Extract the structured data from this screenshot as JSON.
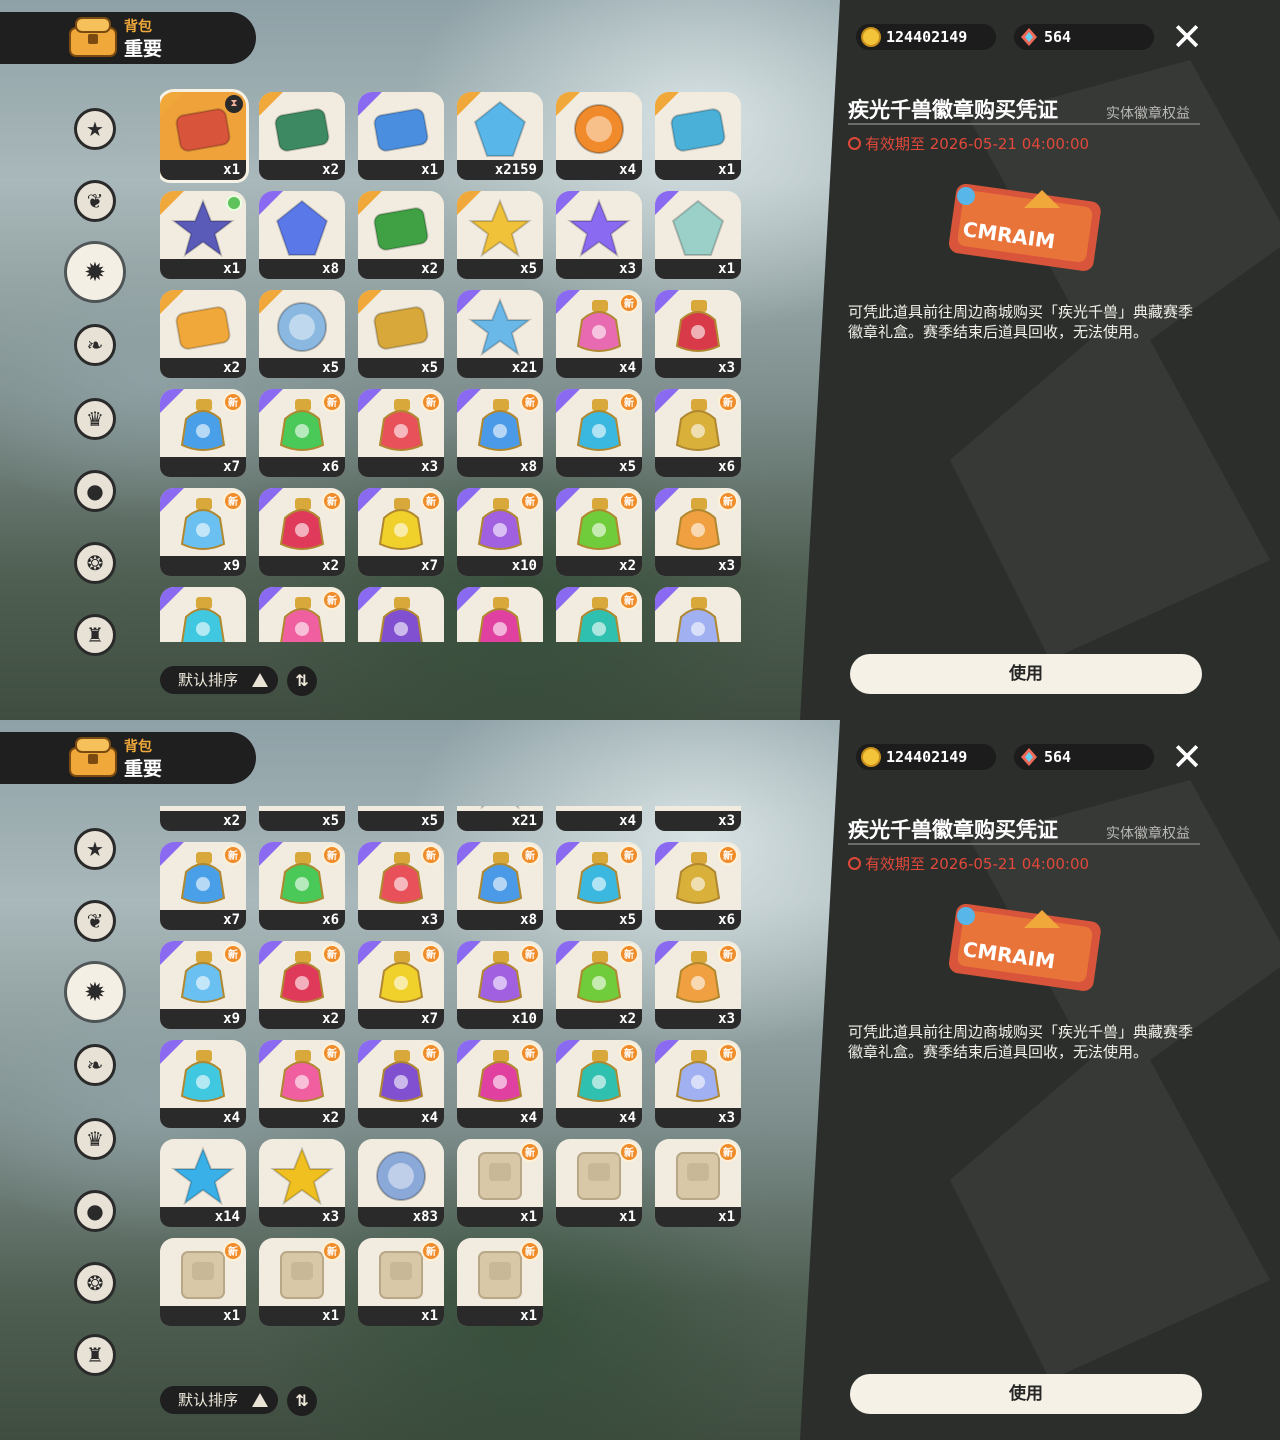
{
  "header": {
    "sub_label": "背包",
    "main_label": "重要"
  },
  "categories": [
    {
      "icon": "star-badge-icon",
      "active": false
    },
    {
      "icon": "leaf-badge-icon",
      "active": false
    },
    {
      "icon": "important-star-icon",
      "active": true
    },
    {
      "icon": "plant-badge-icon",
      "active": false
    },
    {
      "icon": "crown-card-icon",
      "active": false
    },
    {
      "icon": "ball-icon",
      "active": false
    },
    {
      "icon": "acorn-icon",
      "active": false
    },
    {
      "icon": "furniture-icon",
      "active": false
    }
  ],
  "currency": {
    "coins": "124402149",
    "gems": "564"
  },
  "detail": {
    "title": "疾光千兽徽章购买凭证",
    "tag": "实体徽章权益",
    "expiry": "有效期至 2026-05-21 04:00:00",
    "description": "可凭此道具前往周边商城购买「疾光千兽」典藏赛季徽章礼盒。赛季结束后道具回收，无法使用。",
    "use_label": "使用"
  },
  "sort": {
    "label": "默认排序",
    "toggle_label": "⇅"
  },
  "new_badge": "新",
  "items_screen1": [
    {
      "name": "voucher-ticket",
      "count": "x1",
      "rarity": "gold",
      "selected": true,
      "timer": true,
      "color": "#d8543a"
    },
    {
      "name": "gift-envelope",
      "count": "x2",
      "rarity": "gold",
      "color": "#3d8a62"
    },
    {
      "name": "id-card",
      "count": "x1",
      "rarity": "purple",
      "color": "#4a8ee0"
    },
    {
      "name": "prism-crystal",
      "count": "x2159",
      "rarity": "gold",
      "color": "#58b6e8"
    },
    {
      "name": "orange-emblem",
      "count": "x4",
      "rarity": "gold",
      "color": "#f08a2a"
    },
    {
      "name": "water-flask",
      "count": "x1",
      "rarity": "gold",
      "color": "#4ab0d8"
    },
    {
      "name": "star-pouch",
      "count": "x1",
      "rarity": "gold",
      "green": true,
      "color": "#5a5ab8"
    },
    {
      "name": "blue-gem",
      "count": "x8",
      "rarity": "purple",
      "color": "#5a78e8"
    },
    {
      "name": "leaf-seed",
      "count": "x2",
      "rarity": "gold",
      "color": "#3fa044"
    },
    {
      "name": "gold-star",
      "count": "x5",
      "rarity": "gold",
      "color": "#f0c23a"
    },
    {
      "name": "purple-star",
      "count": "x3",
      "rarity": "purple",
      "color": "#8a6af0"
    },
    {
      "name": "crystal-crown",
      "count": "x1",
      "rarity": "purple",
      "color": "#9ad0c8"
    },
    {
      "name": "flame-mask",
      "count": "x2",
      "rarity": "gold",
      "color": "#f0a83a"
    },
    {
      "name": "blue-disc",
      "count": "x5",
      "rarity": "gold",
      "color": "#8ab8e0"
    },
    {
      "name": "golden-key",
      "count": "x5",
      "rarity": "gold",
      "color": "#d8a83a"
    },
    {
      "name": "star-wand",
      "count": "x21",
      "rarity": "purple",
      "color": "#6ab8e8"
    },
    {
      "name": "rainbow-potion",
      "count": "x4",
      "rarity": "purple",
      "new": true,
      "color": "#e86ab0"
    },
    {
      "name": "red-potion",
      "count": "x3",
      "rarity": "purple",
      "color": "#d83a4a"
    },
    {
      "name": "potion-blue-star",
      "count": "x7",
      "rarity": "purple",
      "new": true,
      "color": "#4aa0e8"
    },
    {
      "name": "potion-green",
      "count": "x6",
      "rarity": "purple",
      "new": true,
      "color": "#4ac858"
    },
    {
      "name": "potion-red",
      "count": "x3",
      "rarity": "purple",
      "new": true,
      "color": "#e8505a"
    },
    {
      "name": "potion-blue-drop",
      "count": "x8",
      "rarity": "purple",
      "new": true,
      "color": "#4a9ae8"
    },
    {
      "name": "potion-cyan",
      "count": "x5",
      "rarity": "purple",
      "new": true,
      "color": "#3ab8e0"
    },
    {
      "name": "potion-gold",
      "count": "x6",
      "rarity": "purple",
      "new": true,
      "color": "#d8b03a"
    },
    {
      "name": "potion-ice",
      "count": "x9",
      "rarity": "purple",
      "new": true,
      "color": "#6ac0f0"
    },
    {
      "name": "potion-crimson",
      "count": "x2",
      "rarity": "purple",
      "new": true,
      "color": "#e03a5a"
    },
    {
      "name": "potion-yellow",
      "count": "x7",
      "rarity": "purple",
      "new": true,
      "color": "#f0d02a"
    },
    {
      "name": "potion-violet",
      "count": "x10",
      "rarity": "purple",
      "new": true,
      "color": "#a060e0"
    },
    {
      "name": "potion-lime",
      "count": "x2",
      "rarity": "purple",
      "new": true,
      "color": "#70cc3a"
    },
    {
      "name": "potion-orange",
      "count": "x3",
      "rarity": "purple",
      "new": true,
      "color": "#f0a040"
    },
    {
      "name": "potion-aqua",
      "count": "",
      "rarity": "purple",
      "color": "#40c8e0"
    },
    {
      "name": "potion-pink",
      "count": "",
      "rarity": "purple",
      "new": true,
      "color": "#f060a0"
    },
    {
      "name": "potion-purple",
      "count": "",
      "rarity": "purple",
      "color": "#8050d0"
    },
    {
      "name": "potion-magenta",
      "count": "",
      "rarity": "purple",
      "color": "#e040a0"
    },
    {
      "name": "potion-teal",
      "count": "",
      "rarity": "purple",
      "new": true,
      "color": "#30c0b0"
    },
    {
      "name": "potion-swirl",
      "count": "",
      "rarity": "purple",
      "color": "#a0b0f0"
    }
  ],
  "items_screen2": [
    {
      "name": "flame-mask",
      "count": "x2",
      "rarity": "gold",
      "color": "#f0a83a"
    },
    {
      "name": "blue-disc",
      "count": "x5",
      "rarity": "gold",
      "color": "#8ab8e0"
    },
    {
      "name": "golden-key",
      "count": "x5",
      "rarity": "gold",
      "color": "#d8a83a"
    },
    {
      "name": "star-wand",
      "count": "x21",
      "rarity": "purple",
      "color": "#6ab8e8"
    },
    {
      "name": "rainbow-potion",
      "count": "x4",
      "rarity": "purple",
      "color": "#e86ab0"
    },
    {
      "name": "red-potion",
      "count": "x3",
      "rarity": "purple",
      "color": "#d83a4a"
    },
    {
      "name": "potion-blue-star",
      "count": "x7",
      "rarity": "purple",
      "new": true,
      "color": "#4aa0e8"
    },
    {
      "name": "potion-green",
      "count": "x6",
      "rarity": "purple",
      "new": true,
      "color": "#4ac858"
    },
    {
      "name": "potion-red",
      "count": "x3",
      "rarity": "purple",
      "new": true,
      "color": "#e8505a"
    },
    {
      "name": "potion-blue-drop",
      "count": "x8",
      "rarity": "purple",
      "new": true,
      "color": "#4a9ae8"
    },
    {
      "name": "potion-cyan",
      "count": "x5",
      "rarity": "purple",
      "new": true,
      "color": "#3ab8e0"
    },
    {
      "name": "potion-gold",
      "count": "x6",
      "rarity": "purple",
      "new": true,
      "color": "#d8b03a"
    },
    {
      "name": "potion-ice",
      "count": "x9",
      "rarity": "purple",
      "new": true,
      "color": "#6ac0f0"
    },
    {
      "name": "potion-crimson",
      "count": "x2",
      "rarity": "purple",
      "new": true,
      "color": "#e03a5a"
    },
    {
      "name": "potion-yellow",
      "count": "x7",
      "rarity": "purple",
      "new": true,
      "color": "#f0d02a"
    },
    {
      "name": "potion-violet",
      "count": "x10",
      "rarity": "purple",
      "new": true,
      "color": "#a060e0"
    },
    {
      "name": "potion-lime",
      "count": "x2",
      "rarity": "purple",
      "new": true,
      "color": "#70cc3a"
    },
    {
      "name": "potion-orange",
      "count": "x3",
      "rarity": "purple",
      "new": true,
      "color": "#f0a040"
    },
    {
      "name": "potion-aqua",
      "count": "x4",
      "rarity": "purple",
      "color": "#40c8e0"
    },
    {
      "name": "potion-pink",
      "count": "x2",
      "rarity": "purple",
      "new": true,
      "color": "#f060a0"
    },
    {
      "name": "potion-purple",
      "count": "x4",
      "rarity": "purple",
      "new": true,
      "color": "#8050d0"
    },
    {
      "name": "potion-magenta",
      "count": "x4",
      "rarity": "purple",
      "new": true,
      "color": "#e040a0"
    },
    {
      "name": "potion-teal",
      "count": "x4",
      "rarity": "purple",
      "new": true,
      "color": "#30c0b0"
    },
    {
      "name": "potion-swirl",
      "count": "x3",
      "rarity": "purple",
      "new": true,
      "color": "#a0b0f0"
    },
    {
      "name": "blue-star-token",
      "count": "x14",
      "rarity": "none",
      "color": "#3ab0e8"
    },
    {
      "name": "gold-star-token",
      "count": "x3",
      "rarity": "none",
      "color": "#f0c020"
    },
    {
      "name": "robot-coin",
      "count": "x83",
      "rarity": "none",
      "color": "#8aa8d8"
    },
    {
      "name": "scroll-1",
      "count": "x1",
      "rarity": "none",
      "new": true,
      "color": "#d8c8a8"
    },
    {
      "name": "scroll-2",
      "count": "x1",
      "rarity": "none",
      "new": true,
      "color": "#d8c8a8"
    },
    {
      "name": "scroll-3",
      "count": "x1",
      "rarity": "none",
      "new": true,
      "color": "#d8c8a8"
    },
    {
      "name": "scroll-4",
      "count": "x1",
      "rarity": "none",
      "new": true,
      "color": "#d8c8a8"
    },
    {
      "name": "scroll-5",
      "count": "x1",
      "rarity": "none",
      "new": true,
      "color": "#d8c8a8"
    },
    {
      "name": "scroll-6",
      "count": "x1",
      "rarity": "none",
      "new": true,
      "color": "#d8c8a8"
    },
    {
      "name": "scroll-7",
      "count": "x1",
      "rarity": "none",
      "new": true,
      "color": "#d8c8a8"
    }
  ]
}
